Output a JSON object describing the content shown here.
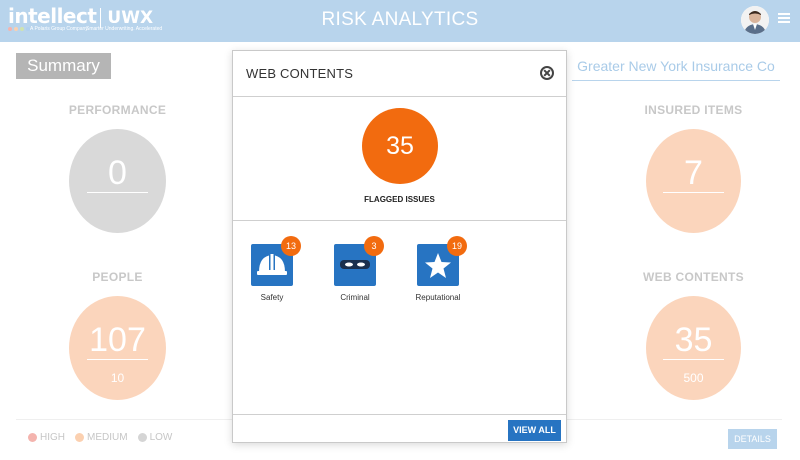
{
  "header": {
    "logo_main": "intellect",
    "logo_uwx": "UWX",
    "logo_tagline": "A Polaris Group Company",
    "logo_tagline2": "Smarter Underwriting. Accelerated",
    "title": "RISK ANALYTICS",
    "colors": {
      "bar": "#b8d4ec"
    }
  },
  "summary_button": "Summary",
  "company_name": "Greater New York Insurance Co",
  "panels": {
    "performance": {
      "title": "PERFORMANCE",
      "value": "0",
      "color": "#d9d9d9"
    },
    "insured_items": {
      "title": "INSURED ITEMS",
      "value": "7",
      "color": "#fbd5bc"
    },
    "people": {
      "title": "PEOPLE",
      "value": "107",
      "sub": "10",
      "color": "#fbd5bc"
    },
    "web_contents": {
      "title": "WEB CONTENTS",
      "value": "35",
      "sub": "500",
      "color": "#fbd5bc"
    }
  },
  "legend": [
    {
      "label": "HIGH",
      "color": "#f4b4ae"
    },
    {
      "label": "MEDIUM",
      "color": "#fbd0b0"
    },
    {
      "label": "LOW",
      "color": "#d5d5d5"
    }
  ],
  "details_button": "DETAILS",
  "modal": {
    "title": "WEB CONTENTS",
    "flagged_count": "35",
    "flagged_label": "FLAGGED ISSUES",
    "categories": [
      {
        "label": "Safety",
        "count": "13",
        "icon": "helmet-icon"
      },
      {
        "label": "Criminal",
        "count": "3",
        "icon": "mask-icon"
      },
      {
        "label": "Reputational",
        "count": "19",
        "icon": "star-icon"
      }
    ],
    "view_all": "VIEW ALL",
    "colors": {
      "accent": "#f26b0f",
      "primary": "#2774c2"
    }
  }
}
